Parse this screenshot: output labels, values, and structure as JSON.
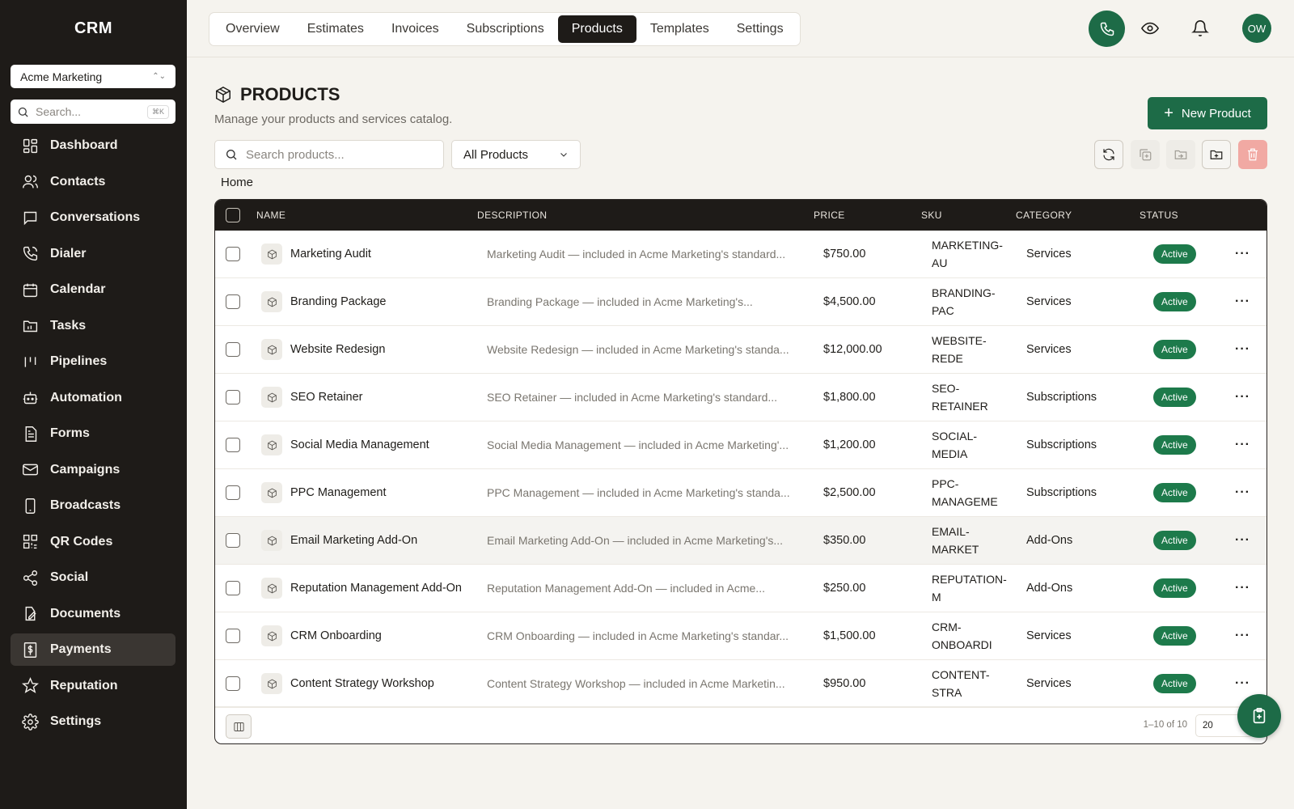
{
  "app": {
    "brand": "CRM",
    "org": "Acme Marketing",
    "search_placeholder": "Search...",
    "search_kbd": "⌘K"
  },
  "sidebar": {
    "items": [
      {
        "label": "Dashboard",
        "icon": "dashboard-icon"
      },
      {
        "label": "Contacts",
        "icon": "contacts-icon"
      },
      {
        "label": "Conversations",
        "icon": "conversations-icon"
      },
      {
        "label": "Dialer",
        "icon": "phone-icon"
      },
      {
        "label": "Calendar",
        "icon": "calendar-icon"
      },
      {
        "label": "Tasks",
        "icon": "tasks-icon"
      },
      {
        "label": "Pipelines",
        "icon": "pipelines-icon"
      },
      {
        "label": "Automation",
        "icon": "automation-icon"
      },
      {
        "label": "Forms",
        "icon": "forms-icon"
      },
      {
        "label": "Campaigns",
        "icon": "mail-icon"
      },
      {
        "label": "Broadcasts",
        "icon": "broadcast-icon"
      },
      {
        "label": "QR Codes",
        "icon": "qr-icon"
      },
      {
        "label": "Social",
        "icon": "share-icon"
      },
      {
        "label": "Documents",
        "icon": "documents-icon"
      },
      {
        "label": "Payments",
        "icon": "payments-icon",
        "active": true
      },
      {
        "label": "Reputation",
        "icon": "star-icon"
      },
      {
        "label": "Settings",
        "icon": "gear-icon"
      }
    ]
  },
  "tabs": [
    "Overview",
    "Estimates",
    "Invoices",
    "Subscriptions",
    "Products",
    "Templates",
    "Settings"
  ],
  "active_tab": "Products",
  "user": {
    "initials": "OW"
  },
  "header": {
    "title": "PRODUCTS",
    "subtitle": "Manage your products and services catalog.",
    "new_button": "New Product"
  },
  "filters": {
    "search_placeholder": "Search products...",
    "category_selected": "All Products"
  },
  "breadcrumb": "Home",
  "table": {
    "columns": [
      "NAME",
      "DESCRIPTION",
      "PRICE",
      "SKU",
      "CATEGORY",
      "STATUS"
    ],
    "rows": [
      {
        "name": "Marketing Audit",
        "desc": "Marketing Audit — included in Acme Marketing's standard...",
        "price": "$750.00",
        "sku1": "MARKETING-",
        "sku2": "AU",
        "cat": "Services",
        "status": "Active"
      },
      {
        "name": "Branding Package",
        "desc": "Branding Package — included in Acme Marketing's...",
        "price": "$4,500.00",
        "sku1": "BRANDING-",
        "sku2": "PAC",
        "cat": "Services",
        "status": "Active"
      },
      {
        "name": "Website Redesign",
        "desc": "Website Redesign — included in Acme Marketing's standa...",
        "price": "$12,000.00",
        "sku1": "WEBSITE-",
        "sku2": "REDE",
        "cat": "Services",
        "status": "Active"
      },
      {
        "name": "SEO Retainer",
        "desc": "SEO Retainer — included in Acme Marketing's standard...",
        "price": "$1,800.00",
        "sku1": "SEO-",
        "sku2": "RETAINER",
        "cat": "Subscriptions",
        "status": "Active"
      },
      {
        "name": "Social Media Management",
        "desc": "Social Media Management — included in Acme Marketing'...",
        "price": "$1,200.00",
        "sku1": "SOCIAL-",
        "sku2": "MEDIA",
        "cat": "Subscriptions",
        "status": "Active"
      },
      {
        "name": "PPC Management",
        "desc": "PPC Management — included in Acme Marketing's standa...",
        "price": "$2,500.00",
        "sku1": "PPC-",
        "sku2": "MANAGEME",
        "cat": "Subscriptions",
        "status": "Active"
      },
      {
        "name": "Email Marketing Add-On",
        "desc": "Email Marketing Add-On — included in Acme Marketing's...",
        "price": "$350.00",
        "sku1": "EMAIL-",
        "sku2": "MARKET",
        "cat": "Add-Ons",
        "status": "Active"
      },
      {
        "name": "Reputation Management Add-On",
        "desc": "Reputation Management Add-On — included in Acme...",
        "price": "$250.00",
        "sku1": "REPUTATION-",
        "sku2": "M",
        "cat": "Add-Ons",
        "status": "Active"
      },
      {
        "name": "CRM Onboarding",
        "desc": "CRM Onboarding — included in Acme Marketing's standar...",
        "price": "$1,500.00",
        "sku1": "CRM-",
        "sku2": "ONBOARDI",
        "cat": "Services",
        "status": "Active"
      },
      {
        "name": "Content Strategy Workshop",
        "desc": "Content Strategy Workshop — included in Acme Marketin...",
        "price": "$950.00",
        "sku1": "CONTENT-",
        "sku2": "STRA",
        "cat": "Services",
        "status": "Active"
      }
    ],
    "pagination": {
      "info": "1–10 of 10",
      "page_size": "20"
    }
  },
  "colors": {
    "accent": "#1d6b47",
    "sidebar_bg": "#1e1b18",
    "danger_soft": "#f1a9a3"
  }
}
